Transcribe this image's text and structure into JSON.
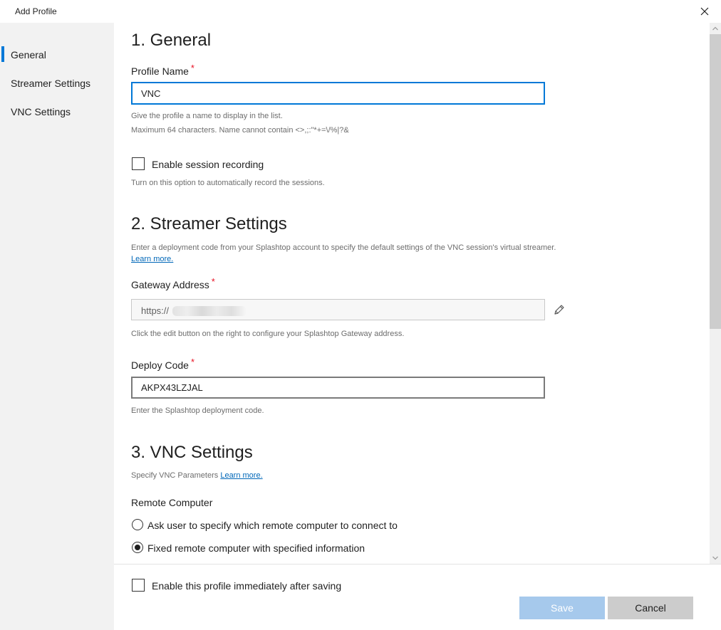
{
  "window": {
    "title": "Add Profile"
  },
  "sidebar": {
    "items": [
      {
        "label": "General",
        "active": true
      },
      {
        "label": "Streamer Settings",
        "active": false
      },
      {
        "label": "VNC Settings",
        "active": false
      }
    ]
  },
  "general": {
    "heading": "1. General",
    "profile_name": {
      "label": "Profile Name",
      "required_mark": "*",
      "value": "VNC",
      "help_line1": "Give the profile a name to display in the list.",
      "help_line2": "Maximum 64 characters. Name cannot contain <>,;:\"*+=\\/%|?&"
    },
    "recording": {
      "label": "Enable session recording",
      "help": "Turn on this option to automatically record the sessions."
    }
  },
  "streamer": {
    "heading": "2. Streamer Settings",
    "description": "Enter a deployment code from your Splashtop account to specify the default settings of the VNC session's virtual streamer.",
    "learn_more": "Learn more.",
    "gateway": {
      "label": "Gateway Address",
      "required_mark": "*",
      "value": "https://",
      "help": "Click the edit button on the right to configure your Splashtop Gateway address."
    },
    "deploy_code": {
      "label": "Deploy Code",
      "required_mark": "*",
      "value": "AKPX43LZJAL",
      "help": "Enter the Splashtop deployment code."
    }
  },
  "vnc": {
    "heading": "3. VNC Settings",
    "description": "Specify VNC Parameters",
    "learn_more": "Learn more.",
    "remote_computer": {
      "label": "Remote Computer",
      "options": [
        {
          "label": "Ask user to specify which remote computer to connect to",
          "selected": false
        },
        {
          "label": "Fixed remote computer with specified information",
          "selected": true
        }
      ]
    }
  },
  "footer": {
    "enable_label": "Enable this profile immediately after saving",
    "save_label": "Save",
    "cancel_label": "Cancel"
  },
  "colors": {
    "accent": "#0078d7",
    "required": "#e81123",
    "save_disabled": "#a6c9ec",
    "cancel_bg": "#cccccc",
    "link": "#0067b8"
  },
  "icons": {
    "close": "close-icon",
    "edit": "pencil-icon",
    "scroll_up": "chevron-up-icon",
    "scroll_down": "chevron-down-icon"
  }
}
